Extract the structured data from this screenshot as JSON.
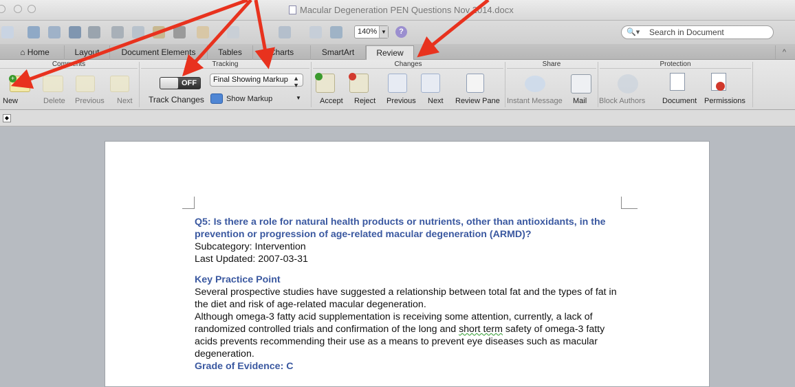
{
  "window": {
    "title": "Macular Degeneration PEN Questions Nov 2014.docx"
  },
  "toolbar": {
    "zoom": "140%",
    "search_placeholder": "Search in Document"
  },
  "ribbon_tabs": [
    "Home",
    "Layout",
    "Document Elements",
    "Tables",
    "Charts",
    "SmartArt",
    "Review"
  ],
  "active_tab": "Review",
  "groups": {
    "comments": {
      "title": "Comments",
      "buttons": [
        "New",
        "Delete",
        "Previous",
        "Next"
      ]
    },
    "tracking": {
      "title": "Tracking",
      "toggle_state": "OFF",
      "markup_selected": "Final Showing Markup",
      "track_changes_label": "Track Changes",
      "show_markup_label": "Show Markup"
    },
    "changes": {
      "title": "Changes",
      "buttons": [
        "Accept",
        "Reject",
        "Previous",
        "Next",
        "Review Pane"
      ]
    },
    "share": {
      "title": "Share",
      "buttons": [
        "Instant Message",
        "Mail"
      ]
    },
    "protection": {
      "title": "Protection",
      "buttons": [
        "Block Authors",
        "Document",
        "Permissions"
      ]
    }
  },
  "document": {
    "question_heading": "Q5: Is there a role for natural health products or nutrients, other than antioxidants, in the prevention or progression of age-related macular degeneration (ARMD)?",
    "subcategory": "Subcategory: Intervention",
    "last_updated": "Last Updated: 2007-03-31",
    "section_heading": "Key Practice Point",
    "paragraph1": "Several prospective studies have suggested a relationship between total fat and the types of fat in the diet and risk of age-related macular degeneration.",
    "paragraph2_before": "Although omega-3 fatty acid supplementation is receiving some attention, currently, a lack of randomized controlled trials and confirmation of the long and ",
    "paragraph2_flagged": "short term",
    "paragraph2_after": " safety of omega-3 fatty acids prevents recommending their use as a means to prevent eye diseases such as macular degeneration.",
    "grade": "Grade of Evidence: C"
  },
  "colors": {
    "heading_blue": "#3a58a0",
    "annotation_arrow": "#e8321e"
  }
}
